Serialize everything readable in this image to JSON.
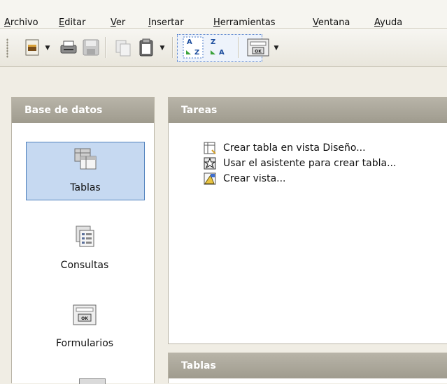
{
  "menubar": {
    "items": [
      {
        "label": "Archivo"
      },
      {
        "label": "Editar"
      },
      {
        "label": "Ver"
      },
      {
        "label": "Insertar"
      },
      {
        "label": "Herramientas"
      },
      {
        "label": "Ventana"
      },
      {
        "label": "Ayuda"
      }
    ]
  },
  "toolbar": {
    "buttons": [
      {
        "icon": "new-document-icon"
      },
      {
        "icon": "print-icon"
      },
      {
        "icon": "save-icon"
      },
      {
        "icon": "copy-icon"
      },
      {
        "icon": "paste-icon"
      },
      {
        "icon": "sort-ascending-icon",
        "text": "A Z"
      },
      {
        "icon": "sort-descending-icon",
        "text": "Z A"
      },
      {
        "icon": "form-icon",
        "text": "OK"
      }
    ]
  },
  "left_panel": {
    "title": "Base de datos",
    "items": [
      {
        "label": "Tablas",
        "selected": true,
        "icon": "tables-icon"
      },
      {
        "label": "Consultas",
        "selected": false,
        "icon": "queries-icon"
      },
      {
        "label": "Formularios",
        "selected": false,
        "icon": "forms-icon",
        "icon_text": "OK"
      }
    ]
  },
  "tasks_panel": {
    "title": "Tareas",
    "tasks": [
      {
        "label": "Crear tabla en vista Diseño...",
        "icon": "design-view-icon"
      },
      {
        "label": "Usar el asistente para crear tabla...",
        "icon": "wizard-icon"
      },
      {
        "label": "Crear vista...",
        "icon": "create-view-icon"
      }
    ]
  },
  "tables_panel": {
    "title": "Tablas"
  },
  "colors": {
    "accent_selection": "#c6d9f1",
    "selection_border": "#4f81bd",
    "panel_header": "#a9a598"
  }
}
